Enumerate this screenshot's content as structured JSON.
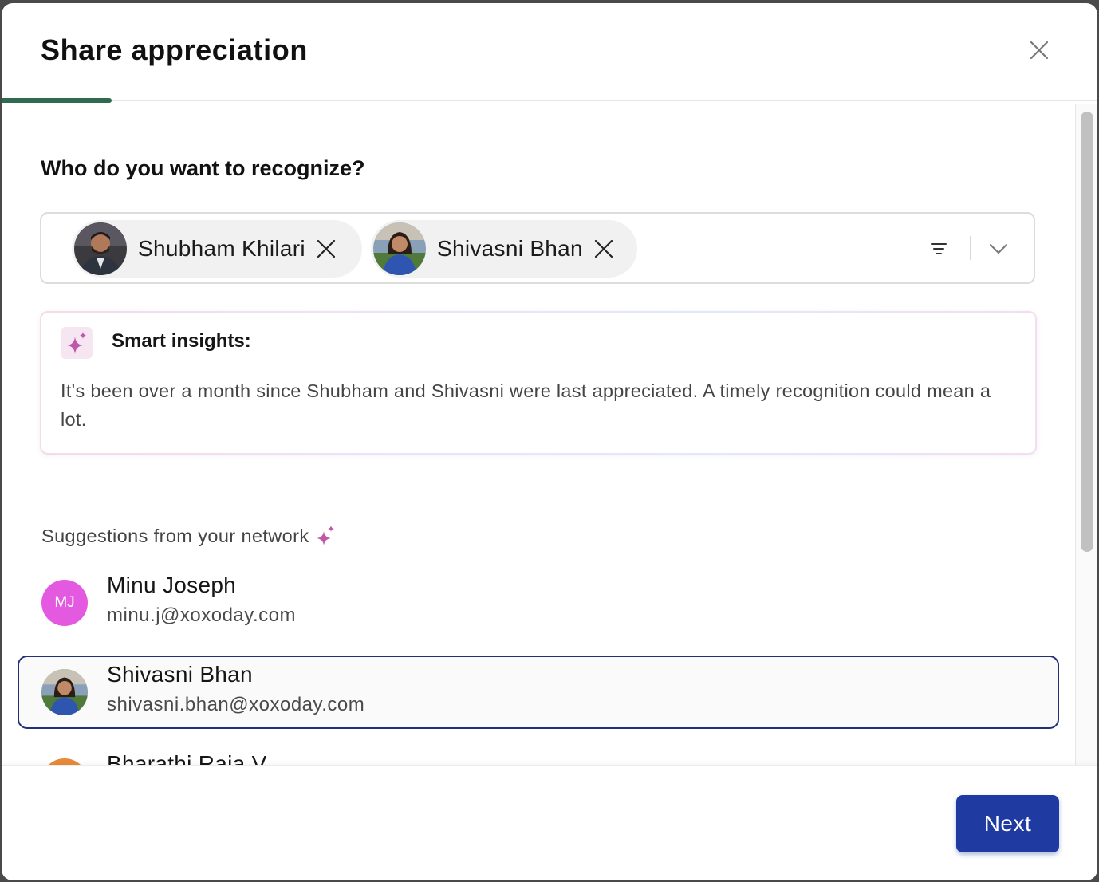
{
  "modal": {
    "title": "Share appreciation",
    "progress_fraction": 0.1
  },
  "recognize": {
    "question": "Who do you want to recognize?",
    "selected": [
      {
        "name": "Shubham Khilari",
        "avatar": "photo"
      },
      {
        "name": "Shivasni Bhan",
        "avatar": "photo"
      }
    ]
  },
  "insights": {
    "title": "Smart insights:",
    "text": "It's been over a month since Shubham and Shivasni were last appreciated. A timely recognition could mean a lot."
  },
  "suggestions": {
    "heading": "Suggestions from your network",
    "people": [
      {
        "name": "Minu Joseph",
        "email": "minu.j@xoxoday.com",
        "initials": "MJ",
        "avatar_color": "#e35ae0"
      },
      {
        "name": "Shivasni Bhan",
        "email": "shivasni.bhan@xoxoday.com",
        "selected": true
      },
      {
        "name": "Bharathi Raja V",
        "partial": true
      }
    ]
  },
  "footer": {
    "next_label": "Next"
  },
  "colors": {
    "accent": "#1f3aa0",
    "progress": "#2e6b4e",
    "selected_border": "#22307a"
  }
}
